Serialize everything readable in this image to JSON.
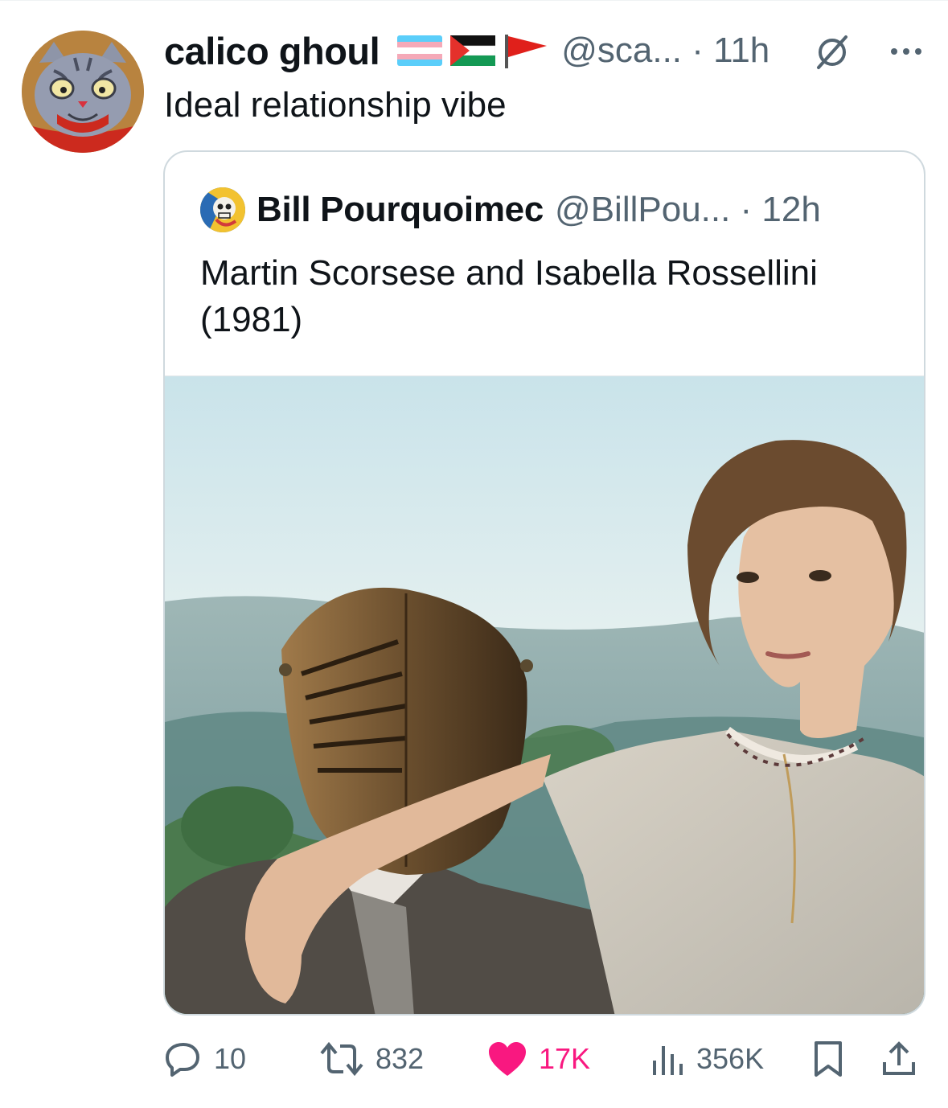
{
  "tweet": {
    "display_name": "calico ghoul",
    "handle_time": "@sca... · 11h",
    "text": "Ideal relationship vibe",
    "flags": [
      "transgender-flag",
      "palestine-flag",
      "red-flag"
    ]
  },
  "quoted": {
    "display_name": "Bill Pourquoimec",
    "handle_time": "@BillPou... · 12h",
    "text": "Martin Scorsese and Isabella Rossellini (1981)"
  },
  "actions": {
    "replies": "10",
    "reposts": "832",
    "likes": "17K",
    "views": "356K"
  },
  "colors": {
    "text_primary": "#0f1419",
    "text_secondary": "#536471",
    "like_pink": "#f91880",
    "border": "#cfd9de"
  },
  "icons": [
    "reply-icon",
    "repost-icon",
    "heart-icon",
    "views-icon",
    "bookmark-icon",
    "share-icon",
    "grok-icon",
    "more-icon"
  ]
}
